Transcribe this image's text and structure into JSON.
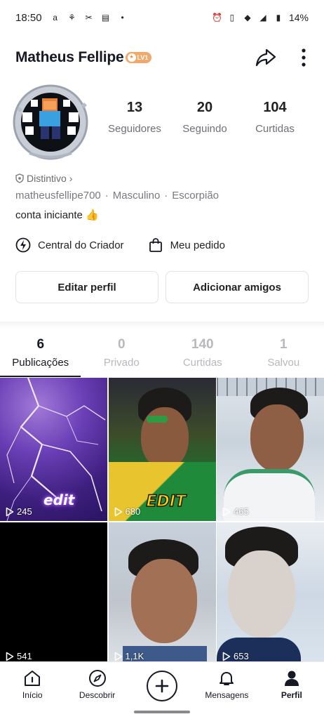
{
  "status_bar": {
    "time": "18:50",
    "battery": "14%"
  },
  "header": {
    "username": "Matheus Fellipe",
    "level": "LV1"
  },
  "stats": {
    "followers_count": "13",
    "followers_label": "Seguidores",
    "following_count": "20",
    "following_label": "Seguindo",
    "likes_count": "104",
    "likes_label": "Curtidas"
  },
  "profile": {
    "distintivo": "Distintivo",
    "handle": "matheusfellipe700",
    "gender": "Masculino",
    "sign": "Escorpião",
    "bio": "conta iniciante 👍"
  },
  "tools": {
    "creator_center": "Central do Criador",
    "my_order": "Meu pedido"
  },
  "buttons": {
    "edit_profile": "Editar perfil",
    "add_friends": "Adicionar amigos"
  },
  "tabs": [
    {
      "count": "6",
      "label": "Publicações"
    },
    {
      "count": "0",
      "label": "Privado"
    },
    {
      "count": "140",
      "label": "Curtidas"
    },
    {
      "count": "1",
      "label": "Salvou"
    }
  ],
  "videos": [
    {
      "views": "245",
      "sticker": "edit"
    },
    {
      "views": "680",
      "sticker": "EDIT"
    },
    {
      "views": "465"
    },
    {
      "views": "541"
    },
    {
      "views": "1,1K"
    },
    {
      "views": "653"
    }
  ],
  "bottom_nav": [
    {
      "label": "Início",
      "icon": "home-icon"
    },
    {
      "label": "Descobrir",
      "icon": "compass-icon"
    },
    {
      "label": "",
      "icon": "plus-icon"
    },
    {
      "label": "Mensagens",
      "icon": "bell-icon"
    },
    {
      "label": "Perfil",
      "icon": "person-icon"
    }
  ]
}
